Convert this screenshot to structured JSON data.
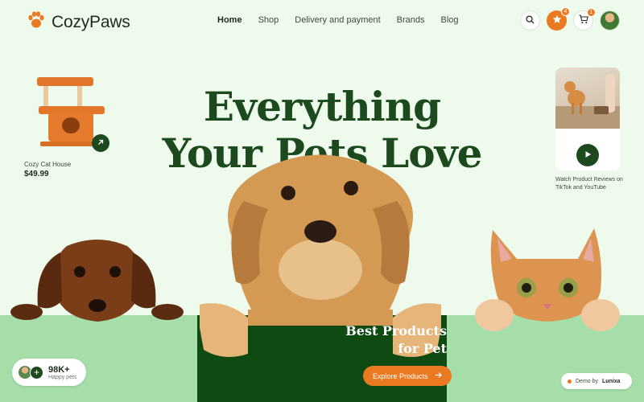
{
  "brand": {
    "name": "CozyPaws",
    "icon": "paw-icon",
    "color": "#ea7a22"
  },
  "nav": [
    {
      "label": "Home",
      "active": true
    },
    {
      "label": "Shop"
    },
    {
      "label": "Delivery and payment"
    },
    {
      "label": "Brands"
    },
    {
      "label": "Blog"
    }
  ],
  "header_actions": {
    "search_icon": "search-icon",
    "favorites": {
      "icon": "star-icon",
      "count": "4"
    },
    "cart": {
      "icon": "cart-icon",
      "count": "1"
    },
    "avatar": "user-avatar"
  },
  "hero": {
    "line1": "Everything",
    "line2": "Your Pets Love"
  },
  "product_card": {
    "name": "Cozy Cat House",
    "price": "$49.99"
  },
  "video_card": {
    "caption": "Watch Product Reviews on TikTok and YouTube"
  },
  "promo": {
    "title": "Best Products for Pet",
    "button_label": "Explore Products"
  },
  "stats": {
    "value": "98K+",
    "label": "Happy pets"
  },
  "demo": {
    "prefix": "Demo by",
    "name": "Lunixa"
  },
  "colors": {
    "accent": "#ea7a22",
    "dark_green": "#1c4a1e",
    "panel_green": "#0f4a12",
    "band_green": "#a6deaa",
    "background": "#eefaec"
  }
}
